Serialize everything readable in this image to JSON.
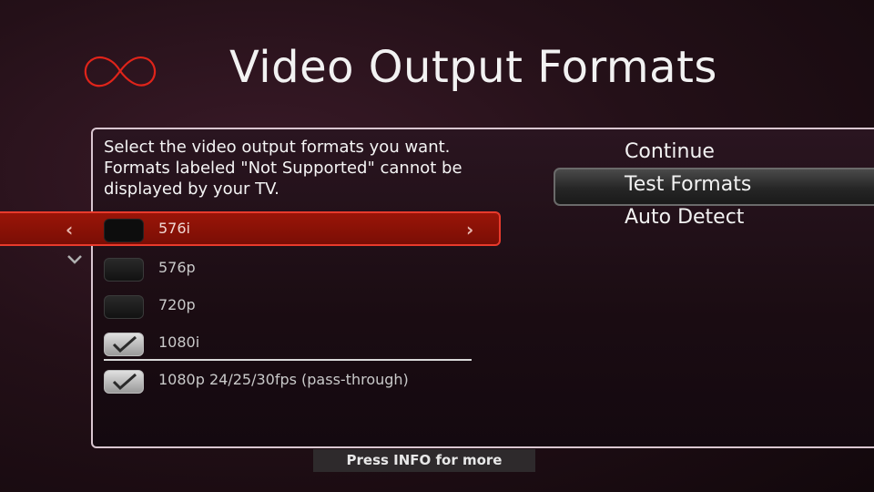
{
  "header": {
    "title": "Video Output Formats",
    "logo_icon": "infinity-logo-icon",
    "accent_color": "#e0241a"
  },
  "description": [
    "Select the video output formats you want.",
    "Formats labeled \"Not Supported\" cannot be",
    "displayed by your TV."
  ],
  "formats": [
    {
      "label": "576i",
      "checked": false,
      "focused": true
    },
    {
      "label": "576p",
      "checked": false,
      "focused": false
    },
    {
      "label": "720p",
      "checked": false,
      "focused": false
    },
    {
      "label": "1080i",
      "checked": true,
      "focused": false
    },
    {
      "label": "1080p 24/25/30fps (pass-through)",
      "checked": true,
      "focused": false
    }
  ],
  "menu": {
    "items": [
      {
        "label": "Continue",
        "selected": false
      },
      {
        "label": "Test Formats",
        "selected": true
      },
      {
        "label": "Auto Detect",
        "selected": false
      }
    ]
  },
  "footer": {
    "info_text": "Press INFO for more"
  }
}
